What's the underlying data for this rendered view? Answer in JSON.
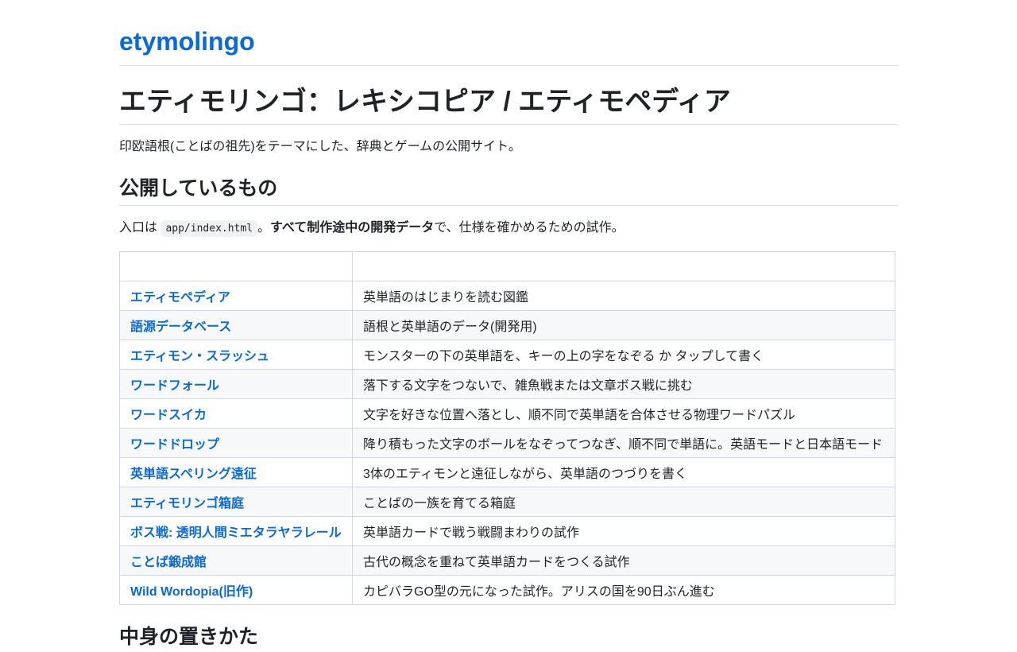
{
  "site": {
    "title": "etymolingo"
  },
  "page": {
    "title": "エティモリンゴ：レキシコピア / エティモペディア",
    "lead": "印欧語根(ことばの祖先)をテーマにした、辞典とゲームの公開サイト。"
  },
  "section_public": {
    "heading": "公開しているもの",
    "intro_prefix": "入口は ",
    "intro_code": "app/index.html",
    "intro_mid": "。",
    "intro_bold": "すべて制作途中の開発データ",
    "intro_suffix": "で、仕様を確かめるための試作。"
  },
  "table": {
    "headers": [
      "",
      ""
    ],
    "rows": [
      {
        "name": "エティモペディア",
        "desc": "英単語のはじまりを読む図鑑"
      },
      {
        "name": "語源データベース",
        "desc": "語根と英単語のデータ(開発用)"
      },
      {
        "name": "エティモン・スラッシュ",
        "desc": "モンスターの下の英単語を、キーの上の字をなぞる か タップして書く"
      },
      {
        "name": "ワードフォール",
        "desc": "落下する文字をつないで、雑魚戦または文章ボス戦に挑む"
      },
      {
        "name": "ワードスイカ",
        "desc": "文字を好きな位置へ落とし、順不同で英単語を合体させる物理ワードパズル"
      },
      {
        "name": "ワードドロップ",
        "desc": "降り積もった文字のボールをなぞってつなぎ、順不同で単語に。英語モードと日本語モード"
      },
      {
        "name": "英単語スペリング遠征",
        "desc": "3体のエティモンと遠征しながら、英単語のつづりを書く"
      },
      {
        "name": "エティモリンゴ箱庭",
        "desc": "ことばの一族を育てる箱庭"
      },
      {
        "name": "ボス戦: 透明人間ミエタラヤラレール",
        "desc": "英単語カードで戦う戦闘まわりの試作"
      },
      {
        "name": "ことば鍛成館",
        "desc": "古代の概念を重ねて英単語カードをつくる試作"
      },
      {
        "name": "Wild Wordopia(旧作)",
        "desc": "カピバラGO型の元になった試作。アリスの国を90日ぶん進む"
      }
    ]
  },
  "section_next": {
    "heading": "中身の置きかた"
  },
  "colors": {
    "link": "#0969da",
    "text": "#1f2328",
    "border": "#d0d7de",
    "row_alt": "#f6f8fa"
  }
}
